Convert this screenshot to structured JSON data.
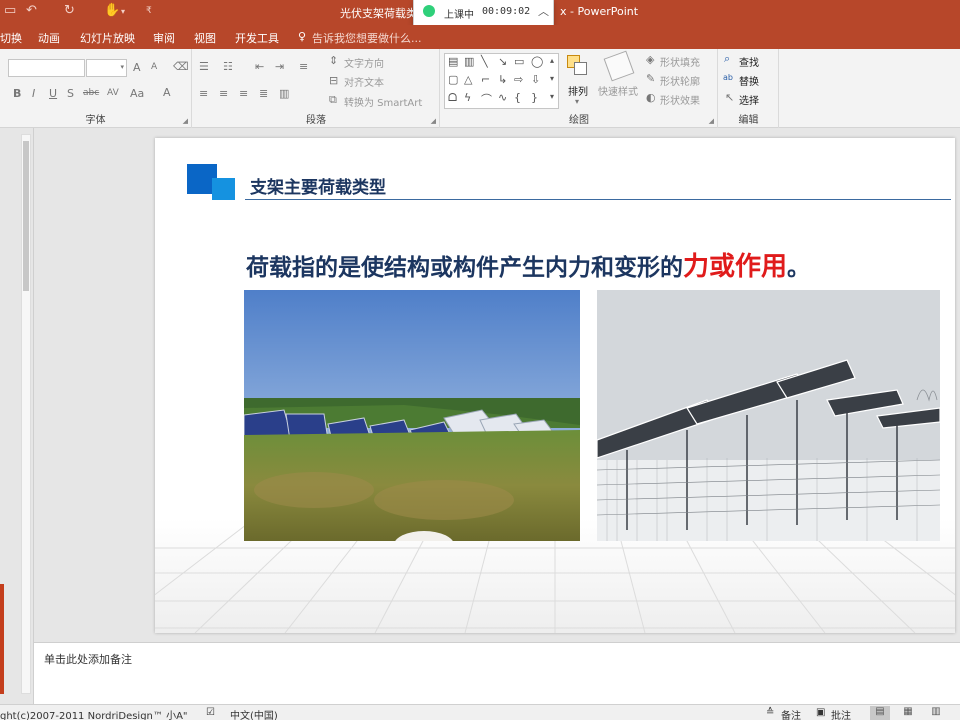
{
  "window": {
    "title": "光伏支架荷载类",
    "title_suffix": "x - PowerPoint"
  },
  "quick_access": {
    "save_icon": "save-icon",
    "undo_icon": "undo-icon",
    "redo_icon": "redo-icon",
    "touch_mode_icon": "touch-mode-icon",
    "customize_icon": "customize-icon"
  },
  "class_timer": {
    "status": "上课中",
    "time": "00:09:02",
    "color": "#2fd07a"
  },
  "ribbon_tabs": [
    "切换",
    "动画",
    "幻灯片放映",
    "审阅",
    "视图",
    "开发工具"
  ],
  "tell_me": "告诉我您想要做什么...",
  "ribbon": {
    "font_group": {
      "label": "字体",
      "font_name": "",
      "font_size": "",
      "bold": "B",
      "italic": "I",
      "underline": "U",
      "shadow": "S",
      "strike": "abc",
      "spacing": "AV",
      "case": "Aa",
      "font_color": "A",
      "grow": "A",
      "shrink": "A"
    },
    "paragraph_group": {
      "label": "段落",
      "text_direction": "文字方向",
      "align_text": "对齐文本",
      "convert_smartart": "转换为 SmartArt"
    },
    "drawing_group": {
      "label": "绘图",
      "arrange": "排列",
      "quick_styles": "快速样式",
      "shape_fill": "形状填充",
      "shape_outline": "形状轮廓",
      "shape_effects": "形状效果"
    },
    "editing_group": {
      "label": "编辑",
      "find": "查找",
      "replace": "替换",
      "select": "选择"
    }
  },
  "slide": {
    "heading": "支架主要荷载类型",
    "statement_prefix": "荷载指的是使结构或构件产生内力和变形的",
    "statement_emphasis": "力或作用",
    "statement_suffix": "。",
    "accent_color": "#1c3660",
    "emphasis_color": "#e01b1b",
    "icon_color": "#0a7fd8"
  },
  "notes": {
    "placeholder": "单击此处添加备注"
  },
  "status_bar": {
    "copyright": "ght(c)2007-2011 NordriDesign™ 小A\"",
    "language": "中文(中国)",
    "notes_label": "备注",
    "comments_label": "批注"
  }
}
